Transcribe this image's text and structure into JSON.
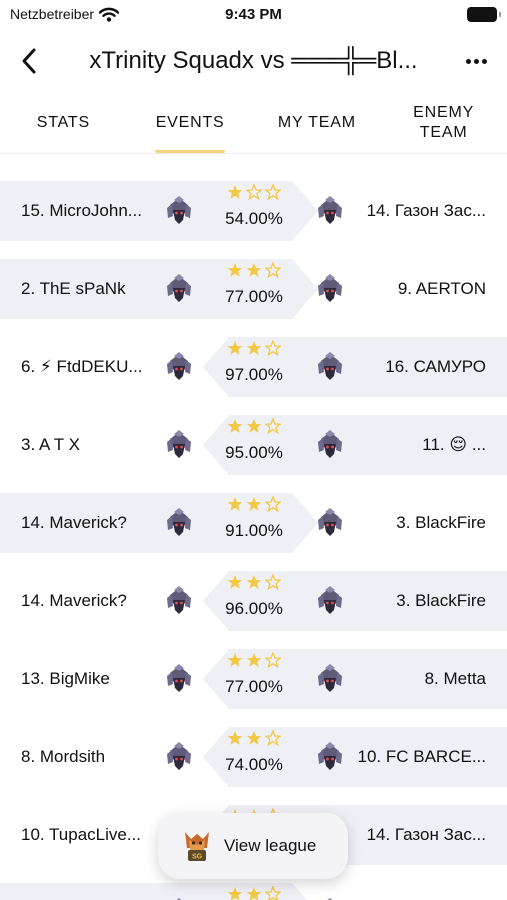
{
  "status_bar": {
    "carrier": "Netzbetreiber",
    "time": "9:43 PM"
  },
  "nav": {
    "title": "xTrinity Squadx vs ═══╬═Bl..."
  },
  "tabs": [
    {
      "label": "STATS",
      "active": false
    },
    {
      "label": "EVENTS",
      "active": true
    },
    {
      "label": "MY TEAM",
      "active": false
    },
    {
      "label": "ENEMY TEAM",
      "active": false
    }
  ],
  "colors": {
    "star": "#f2c844",
    "band": "#efeff6",
    "tab_indicator": "#f4d37a"
  },
  "events": [
    {
      "left": "15. MicroJohn...",
      "right": "14. Газон Зас...",
      "stars": 1,
      "percent": "54.00%",
      "highlight": "left"
    },
    {
      "left": "2. ThE sPaNk",
      "right": "9. AERTON",
      "stars": 2,
      "percent": "77.00%",
      "highlight": "left"
    },
    {
      "left": "6. ⚡ FtdDEKU...",
      "right": "16. САМУРО",
      "stars": 2,
      "percent": "97.00%",
      "highlight": "right"
    },
    {
      "left": "3. A T X",
      "right": "11. 😌 ...",
      "stars": 2,
      "percent": "95.00%",
      "highlight": "right"
    },
    {
      "left": "14. Maverick?",
      "right": "3. BlackFire",
      "stars": 2,
      "percent": "91.00%",
      "highlight": "left"
    },
    {
      "left": "14. Maverick?",
      "right": "3. BlackFire",
      "stars": 2,
      "percent": "96.00%",
      "highlight": "right"
    },
    {
      "left": "13. BigMike",
      "right": "8. Metta",
      "stars": 2,
      "percent": "77.00%",
      "highlight": "right"
    },
    {
      "left": "8. Mordsith",
      "right": "10. FC BARCE...",
      "stars": 2,
      "percent": "74.00%",
      "highlight": "right"
    },
    {
      "left": "10. TupacLive...",
      "right": "14. Газон Зас...",
      "stars": 2,
      "percent": "",
      "highlight": "right"
    },
    {
      "left": "",
      "right": "",
      "stars": 2,
      "percent": "",
      "highlight": "left"
    }
  ],
  "view_league": {
    "label": "View league",
    "badge": "SG"
  }
}
